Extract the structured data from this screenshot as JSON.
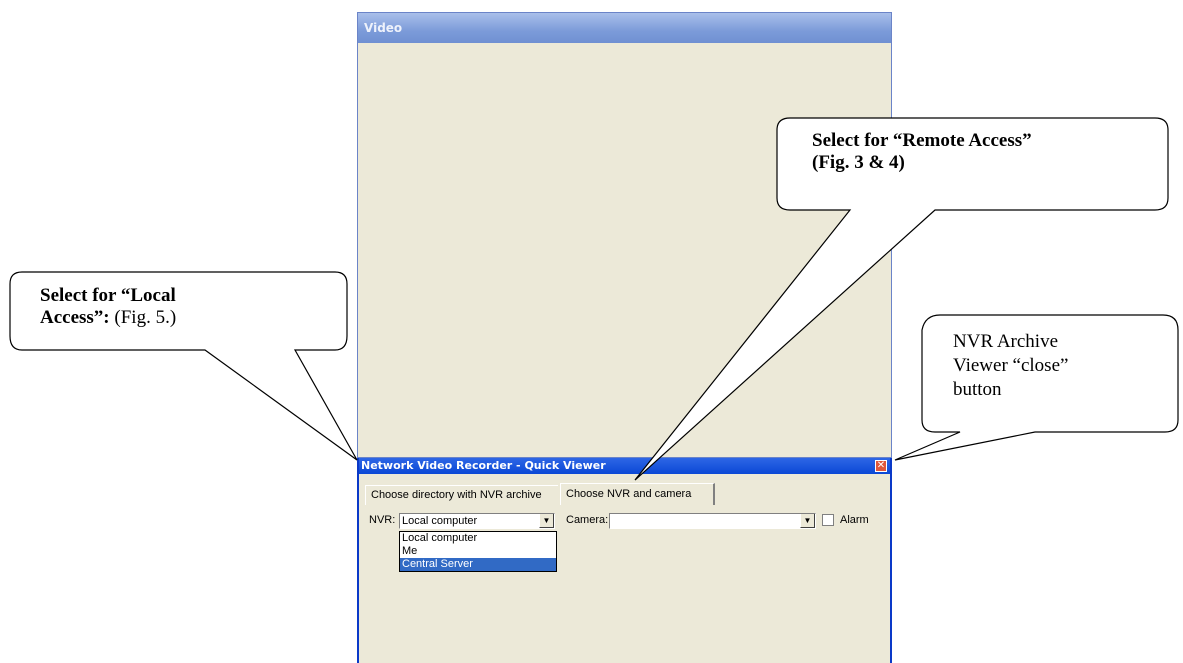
{
  "video_window": {
    "title": "Video"
  },
  "quick_viewer": {
    "title": "Network Video Recorder - Quick Viewer",
    "tabs": [
      {
        "label": "Choose directory with NVR archive"
      },
      {
        "label": "Choose NVR and camera"
      }
    ],
    "nvr_label": "NVR:",
    "nvr_value": "Local computer",
    "camera_label": "Camera:",
    "camera_value": "",
    "alarm_label": "Alarm",
    "nvr_options": [
      "Local computer",
      "Me",
      "Central Server"
    ],
    "selected_option": "Central Server"
  },
  "callouts": {
    "local_bold": "Select for “Local Access”:",
    "local_normal": "(Fig. 5.)",
    "local_line1": "Select for “Local",
    "local_line2_bold": "Access”:",
    "remote_line1": "Select for “Remote Access”",
    "remote_line2": "(Fig. 3 & 4)",
    "close_line1": "NVR Archive",
    "close_line2": "Viewer “close”",
    "close_line3": "button"
  },
  "icons": {
    "close": "close-icon",
    "dropdown": "chevron-down-icon"
  },
  "colors": {
    "titlebar": "#0b48d6",
    "selection": "#316ac5",
    "window_bg": "#ece9d8"
  }
}
